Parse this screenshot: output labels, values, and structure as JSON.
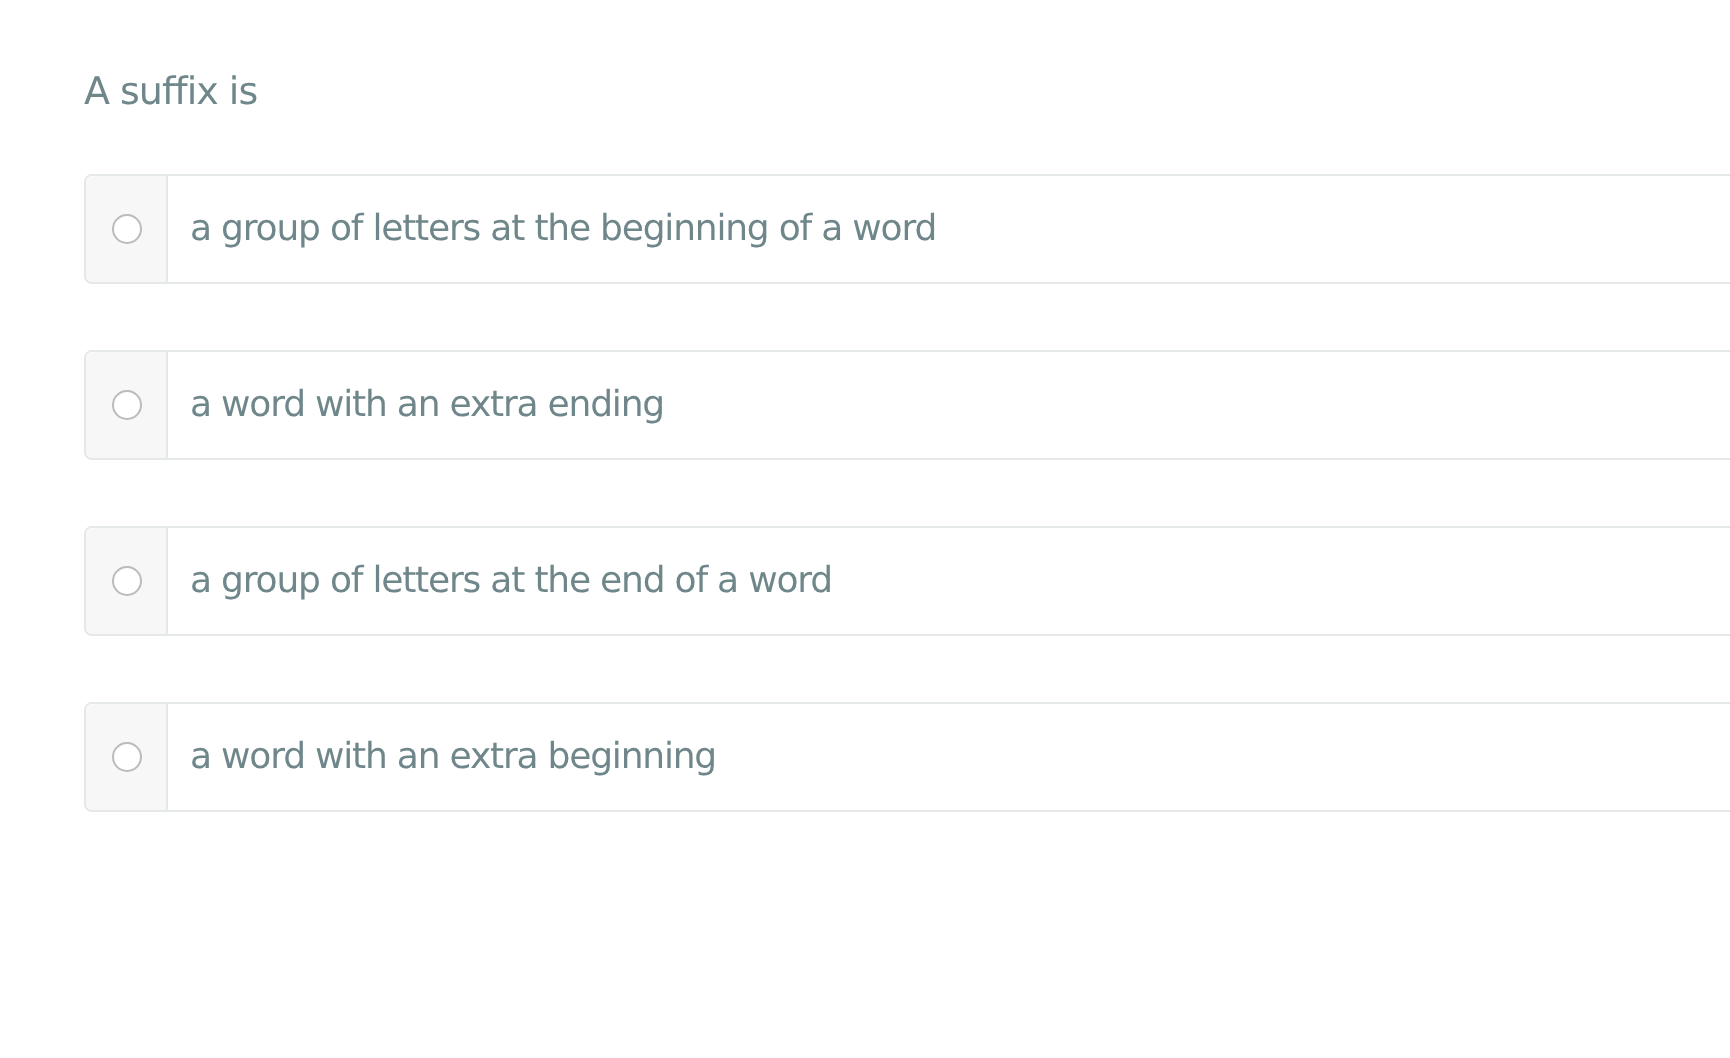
{
  "question": "A suffix is",
  "options": [
    {
      "label": "a group of letters at the beginning of a word",
      "selected": false
    },
    {
      "label": "a word with an extra ending",
      "selected": false
    },
    {
      "label": "a group of letters at the end of a word",
      "selected": false
    },
    {
      "label": "a word with an extra beginning",
      "selected": false
    }
  ]
}
